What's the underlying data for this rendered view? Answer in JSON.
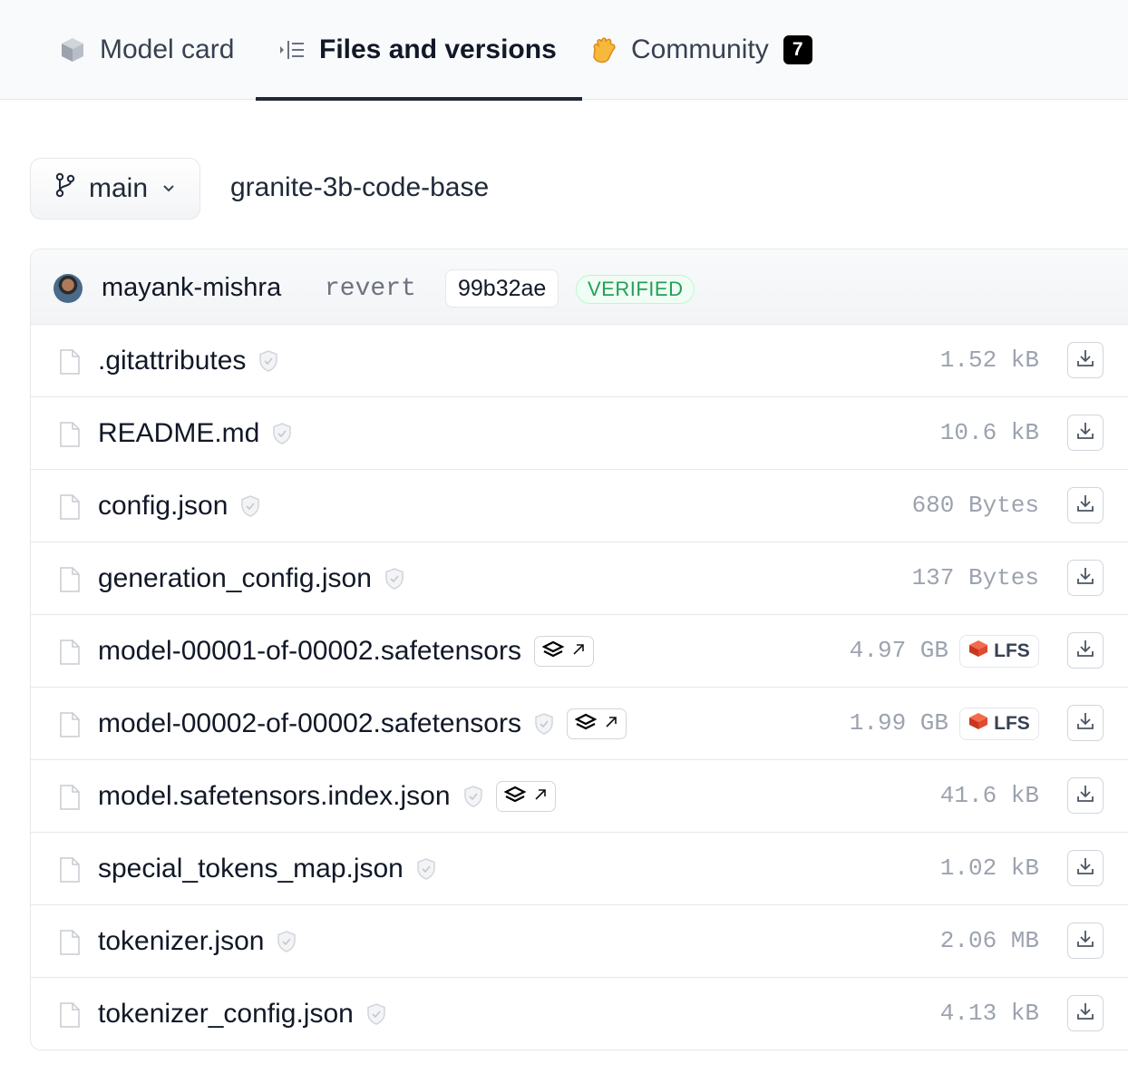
{
  "tabs": {
    "model_card": "Model card",
    "files": "Files and versions",
    "community": "Community",
    "community_count": "7"
  },
  "branch": {
    "name": "main"
  },
  "repo": {
    "name": "granite-3b-code-base"
  },
  "commit": {
    "author": "mayank-mishra",
    "message": "revert",
    "sha": "99b32ae",
    "verified": "VERIFIED"
  },
  "files": [
    {
      "name": ".gitattributes",
      "size": "1.52 kB",
      "lfs": false,
      "safetensors": false,
      "shield": true
    },
    {
      "name": "README.md",
      "size": "10.6 kB",
      "lfs": false,
      "safetensors": false,
      "shield": true
    },
    {
      "name": "config.json",
      "size": "680 Bytes",
      "lfs": false,
      "safetensors": false,
      "shield": true
    },
    {
      "name": "generation_config.json",
      "size": "137 Bytes",
      "lfs": false,
      "safetensors": false,
      "shield": true
    },
    {
      "name": "model-00001-of-00002.safetensors",
      "size": "4.97 GB",
      "lfs": true,
      "safetensors": true,
      "shield": false
    },
    {
      "name": "model-00002-of-00002.safetensors",
      "size": "1.99 GB",
      "lfs": true,
      "safetensors": true,
      "shield": true
    },
    {
      "name": "model.safetensors.index.json",
      "size": "41.6 kB",
      "lfs": false,
      "safetensors": true,
      "shield": true
    },
    {
      "name": "special_tokens_map.json",
      "size": "1.02 kB",
      "lfs": false,
      "safetensors": false,
      "shield": true
    },
    {
      "name": "tokenizer.json",
      "size": "2.06 MB",
      "lfs": false,
      "safetensors": false,
      "shield": true
    },
    {
      "name": "tokenizer_config.json",
      "size": "4.13 kB",
      "lfs": false,
      "safetensors": false,
      "shield": true
    }
  ],
  "lfs_label": "LFS",
  "colors": {
    "verified": "#22a05a",
    "lfs_icon": "#dc4a2e",
    "community_icon": "#f6b93b"
  },
  "icons": {
    "model_card": "cube-icon",
    "files": "list-icon",
    "community": "clapping-hands-icon",
    "branch": "git-branch-icon",
    "file": "file-icon",
    "shield": "shield-check-icon",
    "safetensors": "safetensors-stack-icon",
    "download": "download-icon"
  }
}
